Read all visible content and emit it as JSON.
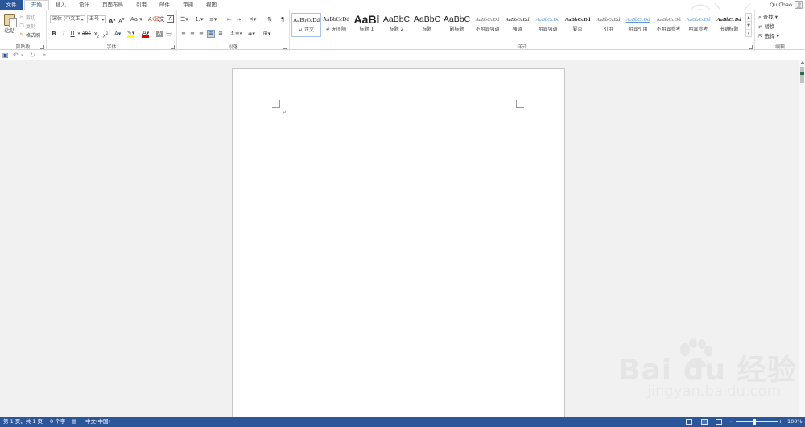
{
  "tabs": {
    "file": "文件",
    "items": [
      "开始",
      "插入",
      "设计",
      "页面布局",
      "引用",
      "邮件",
      "审阅",
      "视图"
    ],
    "active_index": 0
  },
  "user": {
    "name": "Qu Chao"
  },
  "clipboard": {
    "paste": "粘贴",
    "cut": "剪切",
    "copy": "复制",
    "format_painter": "格式刷",
    "label": "剪贴板"
  },
  "font": {
    "name": "宋体 (中文正)",
    "size": "五号",
    "grow": "A",
    "shrink": "A",
    "case": "Aa",
    "bold": "B",
    "italic": "I",
    "underline": "U",
    "strike": "abc",
    "subscript": "x",
    "superscript": "x",
    "font_color": "A",
    "label": "字体"
  },
  "paragraph": {
    "label": "段落"
  },
  "styles": {
    "label": "样式",
    "items": [
      {
        "preview": "AaBbCcDd",
        "name": "正文"
      },
      {
        "preview": "AaBbCcDd",
        "name": "无间隔"
      },
      {
        "preview": "AaBl",
        "name": "标题 1"
      },
      {
        "preview": "AaBbC",
        "name": "标题 2"
      },
      {
        "preview": "AaBbC",
        "name": "标题"
      },
      {
        "preview": "AaBbC",
        "name": "副标题"
      },
      {
        "preview": "AaBbCcDd",
        "name": "不明显强调"
      },
      {
        "preview": "AaBbCcDd",
        "name": "强调"
      },
      {
        "preview": "AaBbCcDd",
        "name": "明显强调"
      },
      {
        "preview": "AaBbCcDd",
        "name": "要点"
      },
      {
        "preview": "AaBbCcDd",
        "name": "引用"
      },
      {
        "preview": "AaBbCcDd",
        "name": "明显引用"
      },
      {
        "preview": "AaBbCcDd",
        "name": "不明显参考"
      },
      {
        "preview": "AaBbCcDd",
        "name": "明显参考"
      },
      {
        "preview": "AaBbCcDd",
        "name": "书籍标题"
      }
    ],
    "selected_index": 0
  },
  "editing": {
    "find": "查找",
    "replace": "替换",
    "select": "选择",
    "label": "编辑"
  },
  "document": {
    "paragraph_mark": "↵"
  },
  "status": {
    "page": "第 1 页，共 1 页",
    "words": "0 个字",
    "language": "中文(中国)",
    "zoom": "100%",
    "zoom_out": "−",
    "zoom_in": "+"
  },
  "watermark": {
    "brand": "Bai du 经验",
    "sub": "jingyan.baidu.com"
  },
  "colors": {
    "accent": "#2b579a",
    "doc_bg": "#f1f1f1",
    "page_bg": "#ffffff"
  }
}
